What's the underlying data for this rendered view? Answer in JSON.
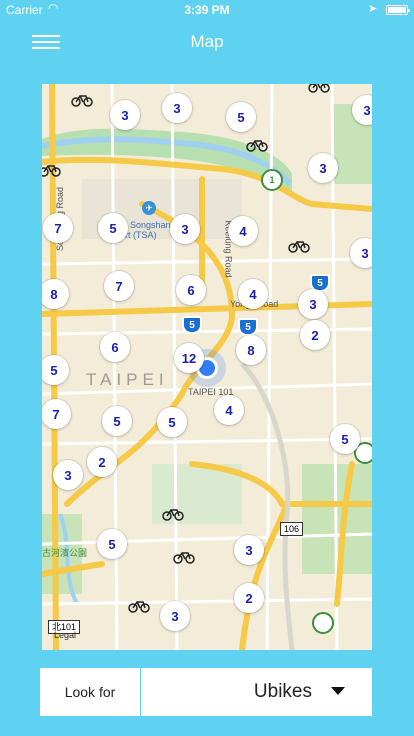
{
  "status_bar": {
    "carrier": "Carrier",
    "time": "3:39 PM"
  },
  "nav": {
    "title": "Map"
  },
  "map": {
    "airport_label": "Taipei Songshan Airport (TSA)",
    "city_label": "TAIPEI",
    "landmark_label": "TAIPEI 101",
    "road_labels": {
      "yongji": "Yongji Road",
      "keelung": "Keelung Road",
      "songjiang": "Songjiang Road",
      "park": "古河濱公園"
    },
    "highway_badges": [
      "106",
      "北101"
    ],
    "legal": "Legal",
    "clusters": [
      "3",
      "3",
      "5",
      "3",
      "1",
      "7",
      "5",
      "3",
      "4",
      "3",
      "8",
      "7",
      "6",
      "4",
      "3",
      "5",
      "6",
      "12",
      "8",
      "2",
      "5",
      "7",
      "5",
      "5",
      "4",
      "3",
      "2",
      "3",
      "5",
      "3",
      "2",
      "3"
    ],
    "shield_labels": [
      "5",
      "5",
      "5"
    ]
  },
  "bottom": {
    "look_for_label": "Look for",
    "selected_option": "Ubikes"
  }
}
